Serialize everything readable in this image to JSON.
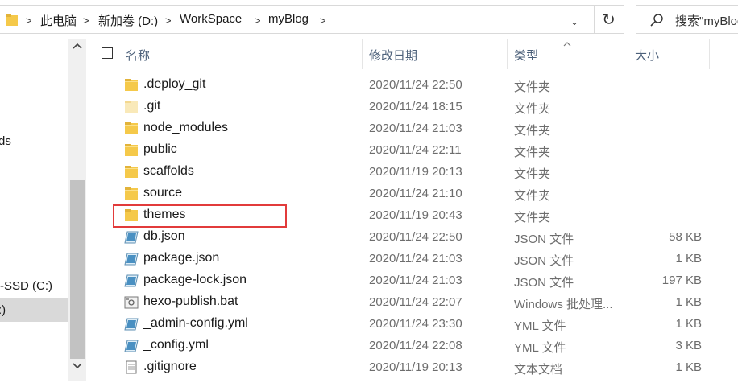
{
  "breadcrumb": {
    "items": [
      "此电脑",
      "新加卷 (D:)",
      "WorkSpace",
      "myBlog"
    ],
    "separator": ">"
  },
  "toolbar": {
    "dropdown_glyph": "⌄",
    "refresh_glyph": "↻"
  },
  "search": {
    "text": "搜索\"myBlog\""
  },
  "nav": {
    "items": [
      "ds",
      "-SSD (C:)",
      ":)"
    ]
  },
  "columns": {
    "name": "名称",
    "date": "修改日期",
    "type": "类型",
    "size": "大小"
  },
  "files": [
    {
      "name": ".deploy_git",
      "date": "2020/11/24 22:50",
      "type": "文件夹",
      "size": "",
      "icon": "folder-icon"
    },
    {
      "name": ".git",
      "date": "2020/11/24 18:15",
      "type": "文件夹",
      "size": "",
      "icon": "hidden-folder-icon"
    },
    {
      "name": "node_modules",
      "date": "2020/11/24 21:03",
      "type": "文件夹",
      "size": "",
      "icon": "folder-icon"
    },
    {
      "name": "public",
      "date": "2020/11/24 22:11",
      "type": "文件夹",
      "size": "",
      "icon": "folder-icon"
    },
    {
      "name": "scaffolds",
      "date": "2020/11/19 20:13",
      "type": "文件夹",
      "size": "",
      "icon": "folder-icon"
    },
    {
      "name": "source",
      "date": "2020/11/24 21:10",
      "type": "文件夹",
      "size": "",
      "icon": "folder-icon"
    },
    {
      "name": "themes",
      "date": "2020/11/19 20:43",
      "type": "文件夹",
      "size": "",
      "icon": "folder-icon"
    },
    {
      "name": "db.json",
      "date": "2020/11/24 22:50",
      "type": "JSON 文件",
      "size": "58 KB",
      "icon": "json-file-icon"
    },
    {
      "name": "package.json",
      "date": "2020/11/24 21:03",
      "type": "JSON 文件",
      "size": "1 KB",
      "icon": "json-file-icon"
    },
    {
      "name": "package-lock.json",
      "date": "2020/11/24 21:03",
      "type": "JSON 文件",
      "size": "197 KB",
      "icon": "json-file-icon"
    },
    {
      "name": "hexo-publish.bat",
      "date": "2020/11/24 22:07",
      "type": "Windows 批处理...",
      "size": "1 KB",
      "icon": "batch-file-icon"
    },
    {
      "name": "_admin-config.yml",
      "date": "2020/11/24 23:30",
      "type": "YML 文件",
      "size": "1 KB",
      "icon": "yml-file-icon"
    },
    {
      "name": "_config.yml",
      "date": "2020/11/24 22:08",
      "type": "YML 文件",
      "size": "3 KB",
      "icon": "yml-file-icon"
    },
    {
      "name": ".gitignore",
      "date": "2020/11/19 20:13",
      "type": "文本文档",
      "size": "1 KB",
      "icon": "text-file-icon"
    }
  ],
  "colors": {
    "highlight": "#e23b3b",
    "folder": "#f5c94a",
    "header_text": "#4c607a"
  }
}
